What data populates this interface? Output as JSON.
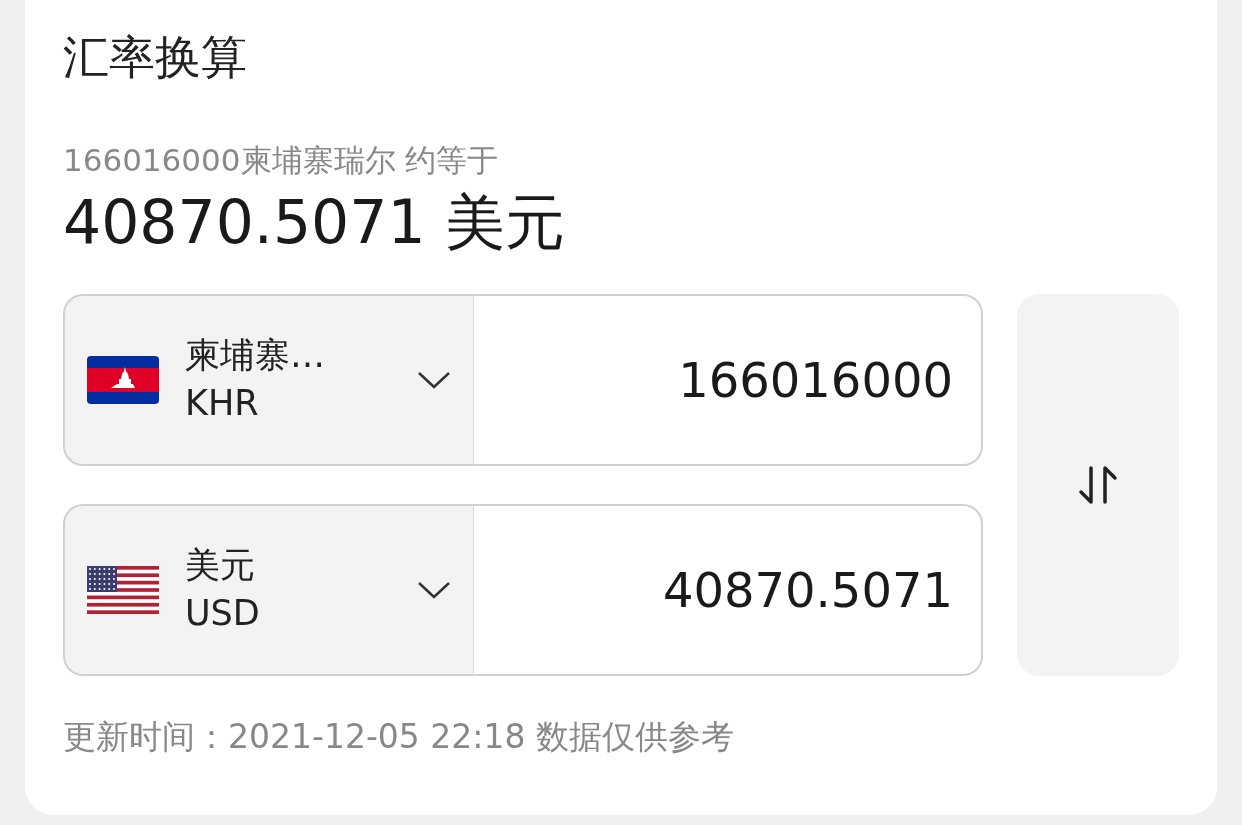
{
  "title": "汇率换算",
  "summary": "166016000柬埔寨瑞尔 约等于",
  "result": "40870.5071 美元",
  "rows": [
    {
      "kind": "cambodia",
      "currency_name": "柬埔寨…",
      "code": "KHR",
      "amount": "166016000"
    },
    {
      "kind": "usa",
      "currency_name": "美元",
      "code": "USD",
      "amount": "40870.5071"
    }
  ],
  "footer": "更新时间：2021-12-05 22:18 数据仅供参考"
}
